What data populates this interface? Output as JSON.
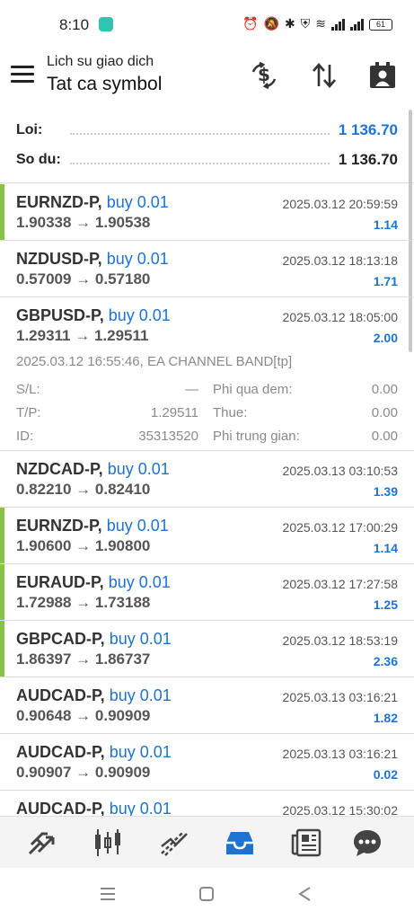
{
  "status_bar": {
    "time": "8:10",
    "battery": "61",
    "icons": [
      "alarm-icon",
      "mute-icon",
      "bluetooth-icon",
      "vpn-icon",
      "wifi-icon",
      "signal-icon",
      "signal-icon",
      "battery-icon"
    ]
  },
  "header": {
    "subtitle": "Lich su giao dich",
    "title": "Tat ca symbol",
    "buttons": [
      "currency-exchange-icon",
      "sort-icon",
      "report-icon"
    ]
  },
  "summary": {
    "profit_label": "Loi:",
    "profit_value": "1 136.70",
    "balance_label": "So du:",
    "balance_value": "1 136.70"
  },
  "colors": {
    "accent_blue": "#1e73d2",
    "closed_bar_green": "#8bc34a",
    "muted_text": "#8a8a8a"
  },
  "trades": [
    {
      "symbol": "EURNZD-P,",
      "action": "buy 0.01",
      "prices": "1.90338 → 1.90538",
      "time": "2025.03.12 20:59:59",
      "profit": "1.14",
      "bar": true
    },
    {
      "symbol": "NZDUSD-P,",
      "action": "buy 0.01",
      "prices": "0.57009 → 0.57180",
      "time": "2025.03.12 18:13:18",
      "profit": "1.71",
      "bar": false
    },
    {
      "symbol": "GBPUSD-P,",
      "action": "buy 0.01",
      "prices": "1.29311 → 1.29511",
      "time": "2025.03.12 18:05:00",
      "profit": "2.00",
      "bar": false,
      "details": {
        "comment": "2025.03.12 16:55:46, EA CHANNEL BAND[tp]",
        "sl_label": "S/L:",
        "sl_value": "—",
        "swap_label": "Phi qua dem:",
        "swap_value": "0.00",
        "tp_label": "T/P:",
        "tp_value": "1.29511",
        "tax_label": "Thue:",
        "tax_value": "0.00",
        "id_label": "ID:",
        "id_value": "35313520",
        "fee_label": "Phi trung gian:",
        "fee_value": "0.00"
      }
    },
    {
      "symbol": "NZDCAD-P,",
      "action": "buy 0.01",
      "prices": "0.82210 → 0.82410",
      "time": "2025.03.13 03:10:53",
      "profit": "1.39",
      "bar": false
    },
    {
      "symbol": "EURNZD-P,",
      "action": "buy 0.01",
      "prices": "1.90600 → 1.90800",
      "time": "2025.03.12 17:00:29",
      "profit": "1.14",
      "bar": true
    },
    {
      "symbol": "EURAUD-P,",
      "action": "buy 0.01",
      "prices": "1.72988 → 1.73188",
      "time": "2025.03.12 17:27:58",
      "profit": "1.25",
      "bar": true
    },
    {
      "symbol": "GBPCAD-P,",
      "action": "buy 0.01",
      "prices": "1.86397 → 1.86737",
      "time": "2025.03.12 18:53:19",
      "profit": "2.36",
      "bar": true
    },
    {
      "symbol": "AUDCAD-P,",
      "action": "buy 0.01",
      "prices": "0.90648 → 0.90909",
      "time": "2025.03.13 03:16:21",
      "profit": "1.82",
      "bar": false
    },
    {
      "symbol": "AUDCAD-P,",
      "action": "buy 0.01",
      "prices": "0.90907 → 0.90909",
      "time": "2025.03.13 03:16:21",
      "profit": "0.02",
      "bar": false
    },
    {
      "symbol": "AUDCAD-P,",
      "action": "buy 0.01",
      "prices": "",
      "time": "2025.03.12 15:30:02",
      "profit": "",
      "bar": false
    }
  ],
  "bottom_nav": {
    "items": [
      "quotes-icon",
      "chart-icon",
      "trade-icon",
      "history-icon",
      "news-icon",
      "chat-icon"
    ],
    "active": "history-icon"
  },
  "system_nav": [
    "recents-icon",
    "home-icon",
    "back-icon"
  ]
}
